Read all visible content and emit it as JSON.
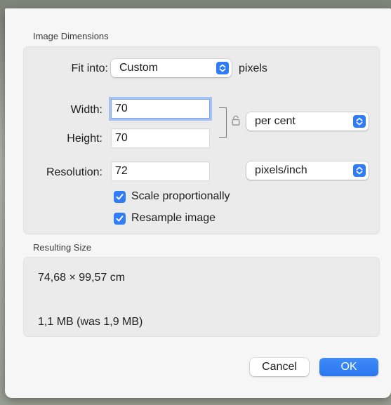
{
  "image_dimensions": {
    "section_title": "Image Dimensions",
    "fit_into": {
      "label": "Fit into:",
      "selected": "Custom",
      "unit": "pixels"
    },
    "width": {
      "label": "Width:",
      "value": "70"
    },
    "height": {
      "label": "Height:",
      "value": "70"
    },
    "size_unit": {
      "selected": "per cent"
    },
    "resolution": {
      "label": "Resolution:",
      "value": "72",
      "unit_selected": "pixels/inch"
    },
    "scale_proportionally": {
      "label": "Scale proportionally",
      "checked": true
    },
    "resample_image": {
      "label": "Resample image",
      "checked": true
    }
  },
  "resulting_size": {
    "section_title": "Resulting Size",
    "dimensions": "74,68 × 99,57 cm",
    "file_size": "1,1 MB (was 1,9 MB)"
  },
  "buttons": {
    "cancel": "Cancel",
    "ok": "OK"
  },
  "colors": {
    "accent": "#2f7cf6",
    "focus_ring": "#5292f7",
    "sheet_background": "#f6f6f6",
    "group_background": "#ebebeb"
  },
  "icons": {
    "lock": "lock-open-icon",
    "popup_chevron": "up-down-chevron-icon",
    "checkmark": "checkmark-icon"
  }
}
